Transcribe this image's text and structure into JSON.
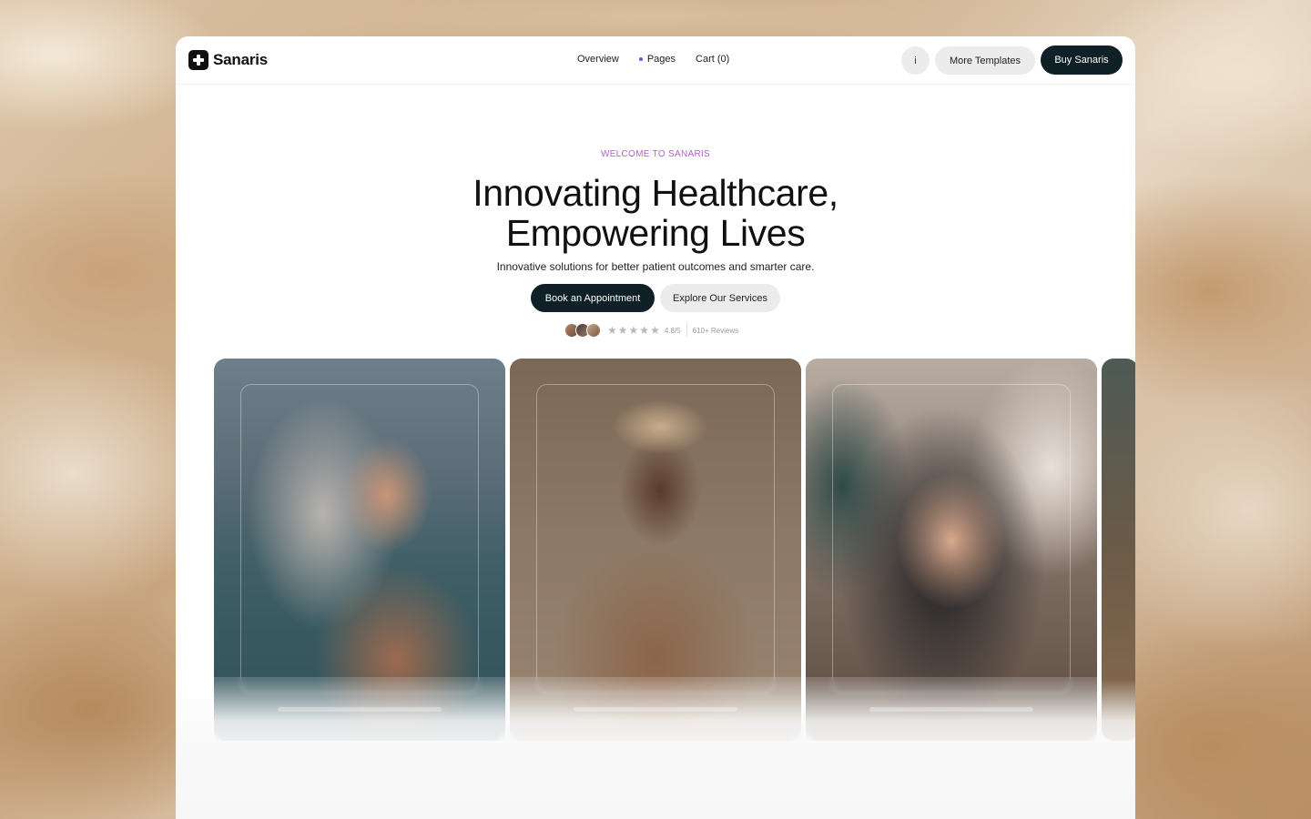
{
  "brand": {
    "name": "Sanaris"
  },
  "nav": {
    "links": [
      "Overview",
      "Pages",
      "Cart (0)"
    ],
    "info_label": "i",
    "more_label": "More Templates",
    "buy_label": "Buy Sanaris"
  },
  "hero": {
    "eyebrow": "WELCOME TO SANARIS",
    "headline_line1": "Innovating Healthcare,",
    "headline_line2": "Empowering Lives",
    "subtitle": "Innovative solutions for better patient outcomes and smarter care.",
    "primary_cta": "Book an Appointment",
    "secondary_cta": "Explore Our Services",
    "rating": "4.8/5",
    "rating_stars": 5,
    "review_count": "610+ Reviews"
  },
  "colors": {
    "accent": "#7b4dd9",
    "eyebrow": "#b45fd6",
    "dark_button": "#0f2026"
  },
  "gallery": {
    "cards": [
      {
        "subject": "older woman with silver hair by the sea"
      },
      {
        "subject": "smiling woman in a cap"
      },
      {
        "subject": "woman with freckles resting chin on hand"
      },
      {
        "subject": "partially visible card"
      }
    ]
  }
}
